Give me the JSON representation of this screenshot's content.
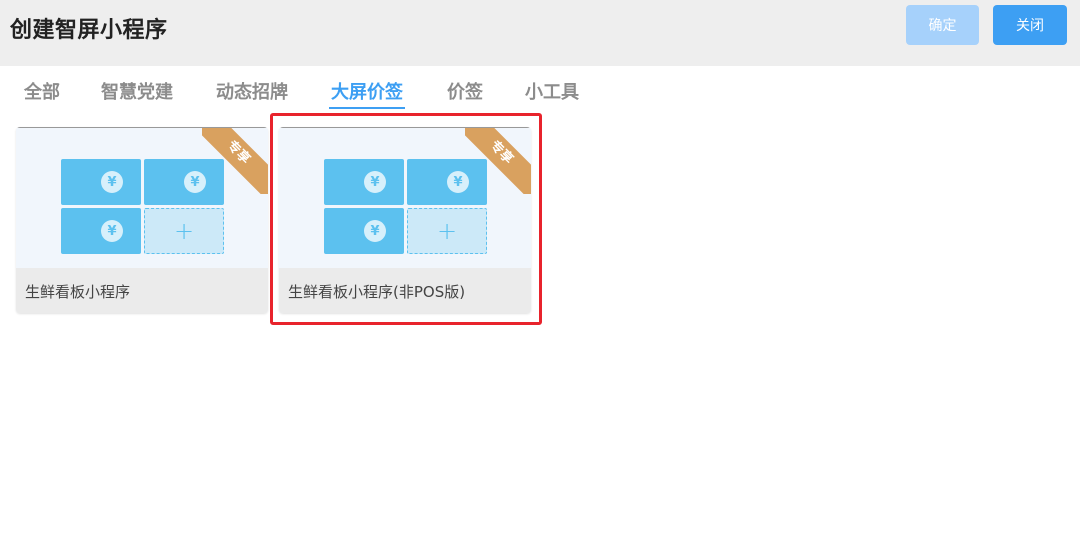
{
  "header": {
    "title": "创建智屏小程序",
    "confirm_label": "确定",
    "close_label": "关闭"
  },
  "tabs": [
    {
      "label": "全部",
      "active": false
    },
    {
      "label": "智慧党建",
      "active": false
    },
    {
      "label": "动态招牌",
      "active": false
    },
    {
      "label": "大屏价签",
      "active": true
    },
    {
      "label": "价签",
      "active": false
    },
    {
      "label": "小工具",
      "active": false
    }
  ],
  "cards": [
    {
      "name": "生鲜看板小程序",
      "badge": "专享",
      "highlighted": false
    },
    {
      "name": "生鲜看板小程序(非POS版)",
      "badge": "专享",
      "highlighted": true
    }
  ],
  "icons": {
    "price_tile": "yen-icon",
    "add_tile": "plus-icon",
    "price_symbol": "¥",
    "add_symbol": "+"
  },
  "colors": {
    "accent": "#3d9ff3",
    "accent_disabled": "#a6d1fb",
    "tile": "#5cc1ef",
    "badge": "#d9a15f",
    "highlight": "#e8232c"
  }
}
